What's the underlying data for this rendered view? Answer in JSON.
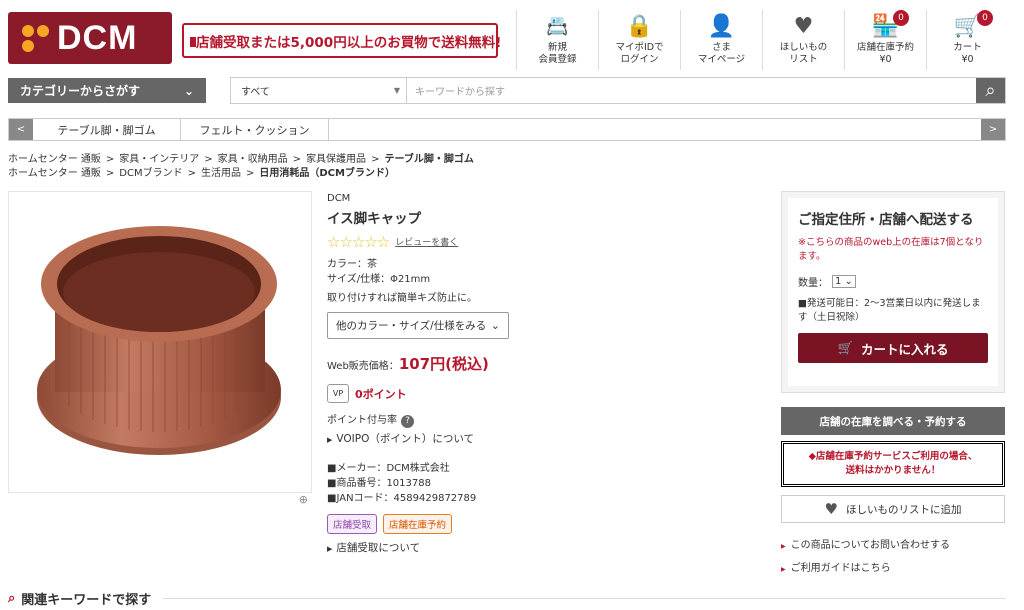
{
  "header": {
    "logo": "DCM",
    "ship_banner": "店舗受取または5,000円以上のお買物で送料無料!",
    "nav": [
      {
        "icon": "id-card-icon",
        "label1": "新規",
        "label2": "会員登録"
      },
      {
        "icon": "lock-icon",
        "label1": "マイポIDで",
        "label2": "ログイン"
      },
      {
        "icon": "person-icon",
        "label1": "さま",
        "label2": "マイページ"
      },
      {
        "icon": "heart-icon",
        "label1": "ほしいもの",
        "label2": "リスト"
      },
      {
        "icon": "store-icon",
        "label1": "店舗在庫予約",
        "label2": "¥0",
        "badge": "0"
      },
      {
        "icon": "cart-icon",
        "label1": "カート",
        "label2": "¥0",
        "badge": "0"
      }
    ]
  },
  "search": {
    "category_label": "カテゴリーからさがす",
    "scope": "すべて",
    "placeholder": "キーワードから探す"
  },
  "subnav": {
    "tabs": [
      "テーブル脚・脚ゴム",
      "フェルト・クッション"
    ]
  },
  "breadcrumbs": {
    "row1": [
      "ホームセンター 通販",
      "家具・インテリア",
      "家具・収納用品",
      "家具保護用品",
      "テーブル脚・脚ゴム"
    ],
    "row2": [
      "ホームセンター 通販",
      "DCMブランド",
      "生活用品",
      "日用消耗品（DCMブランド）"
    ]
  },
  "product": {
    "brand": "DCM",
    "title": "イス脚キャップ",
    "review_link": "レビューを書く",
    "stars": "☆☆☆☆☆",
    "color": "カラー：茶",
    "size": "サイズ/仕様：Φ21mm",
    "desc": "取り付けすれば簡単キズ防止に。",
    "variant_select": "他のカラー・サイズ/仕様をみる",
    "price_label": "Web販売価格：",
    "price": "107円(税込)",
    "points_badge": "VP",
    "points": "0ポイント",
    "point_rate": "ポイント付与率",
    "voipo_link": "VOIPO（ポイント）について",
    "maker": "■メーカー：DCM株式会社",
    "item_no": "■商品番号：1013788",
    "jan": "■JANコード：4589429872789",
    "tag1": "店舗受取",
    "tag2": "店舗在庫予約",
    "pickup_link": "店舗受取について"
  },
  "buybox": {
    "heading": "ご指定住所・店舗へ配送する",
    "stock_note": "※こちらの商品のweb上の在庫は7個となります。",
    "qty_label": "数量：",
    "qty": "1",
    "ship_note": "■発送可能日：2〜3営業日以内に発送します（土日祝除）",
    "cart_button": "カートに入れる"
  },
  "store_button": "店舗の在庫を調べる・予約する",
  "store_note1": "◆店舗在庫予約サービスご利用の場合、",
  "store_note2": "送料はかかりません！",
  "wishlist_button": "ほしいものリストに追加",
  "links": [
    "この商品についてお問い合わせする",
    "ご利用ガイドはこちら"
  ],
  "related_heading": "関連キーワードで探す"
}
